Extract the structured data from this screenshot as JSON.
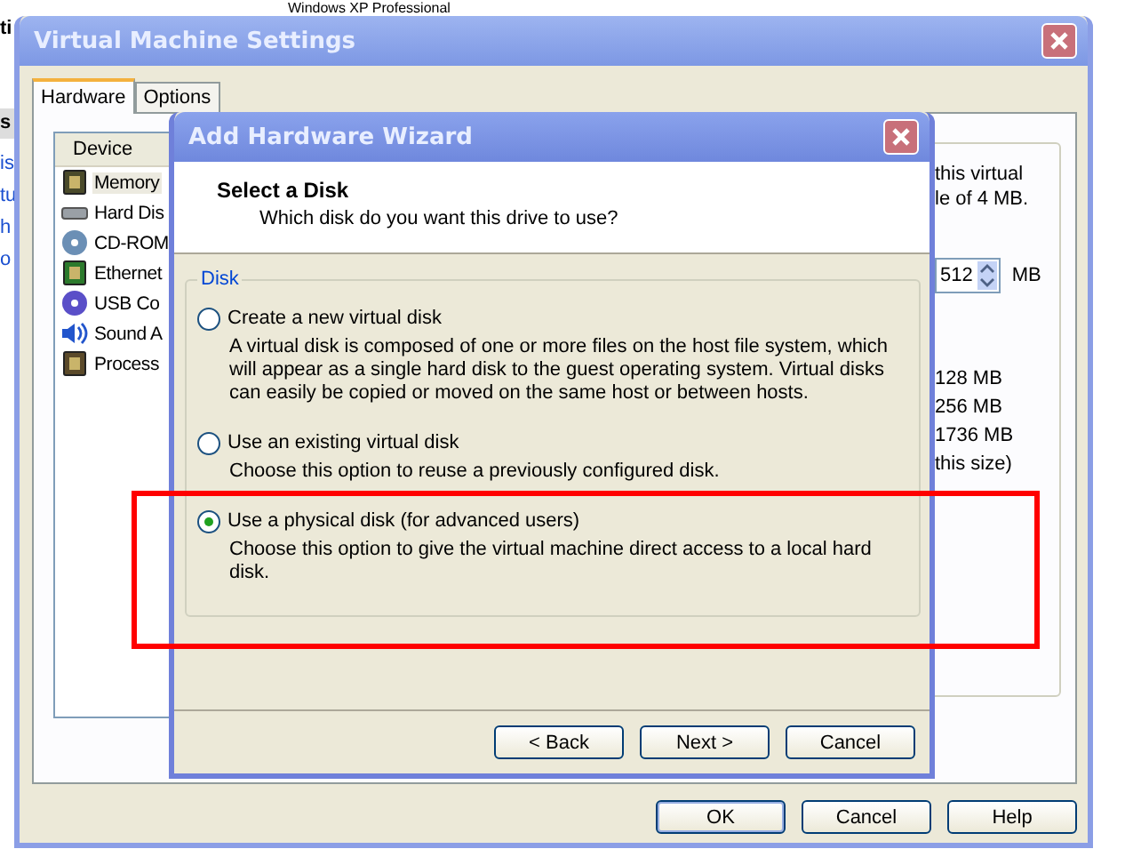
{
  "background": {
    "caption": "Windows XP Professional",
    "fragments": [
      {
        "text": "ti",
        "kind": "bold"
      },
      {
        "text": "s",
        "kind": "header"
      },
      {
        "text": "is",
        "kind": "link"
      },
      {
        "text": "tu",
        "kind": "link"
      },
      {
        "text": "h",
        "kind": "link"
      },
      {
        "text": "o",
        "kind": "link"
      }
    ]
  },
  "settings_window": {
    "title": "Virtual Machine Settings",
    "tabs": [
      {
        "label": "Hardware",
        "selected": true
      },
      {
        "label": "Options",
        "selected": false
      }
    ],
    "device_list": {
      "header": "Device",
      "items": [
        {
          "label": "Memory",
          "selected": true
        },
        {
          "label": "Hard Dis",
          "selected": false
        },
        {
          "label": "CD-ROM",
          "selected": false
        },
        {
          "label": "Ethernet",
          "selected": false
        },
        {
          "label": "USB Co",
          "selected": false
        },
        {
          "label": "Sound A",
          "selected": false
        },
        {
          "label": "Process",
          "selected": false
        }
      ]
    },
    "memory_panel": {
      "lines": [
        "this virtual",
        "le of 4 MB."
      ],
      "spinner_value": "512",
      "unit": "MB",
      "sizes": [
        "128 MB",
        "256 MB",
        "1736 MB",
        "this size)"
      ]
    },
    "buttons": [
      "OK",
      "Cancel",
      "Help"
    ]
  },
  "wizard": {
    "title": "Add Hardware Wizard",
    "heading": "Select a Disk",
    "subheading": "Which disk do you want this drive to use?",
    "group_label": "Disk",
    "options": [
      {
        "label": "Create a new virtual disk",
        "description": "A virtual disk is composed of one or more files on the host file system, which will appear as a single hard disk to the guest operating system. Virtual disks can easily be copied or moved on the same host or between hosts.",
        "selected": false
      },
      {
        "label": "Use an existing virtual disk",
        "description": "Choose this option to reuse a previously configured disk.",
        "selected": false
      },
      {
        "label": "Use a physical disk (for advanced users)",
        "description": "Choose this option to give the virtual machine direct access to a local hard disk.",
        "selected": true
      }
    ],
    "buttons": [
      "< Back",
      "Next >",
      "Cancel"
    ]
  }
}
